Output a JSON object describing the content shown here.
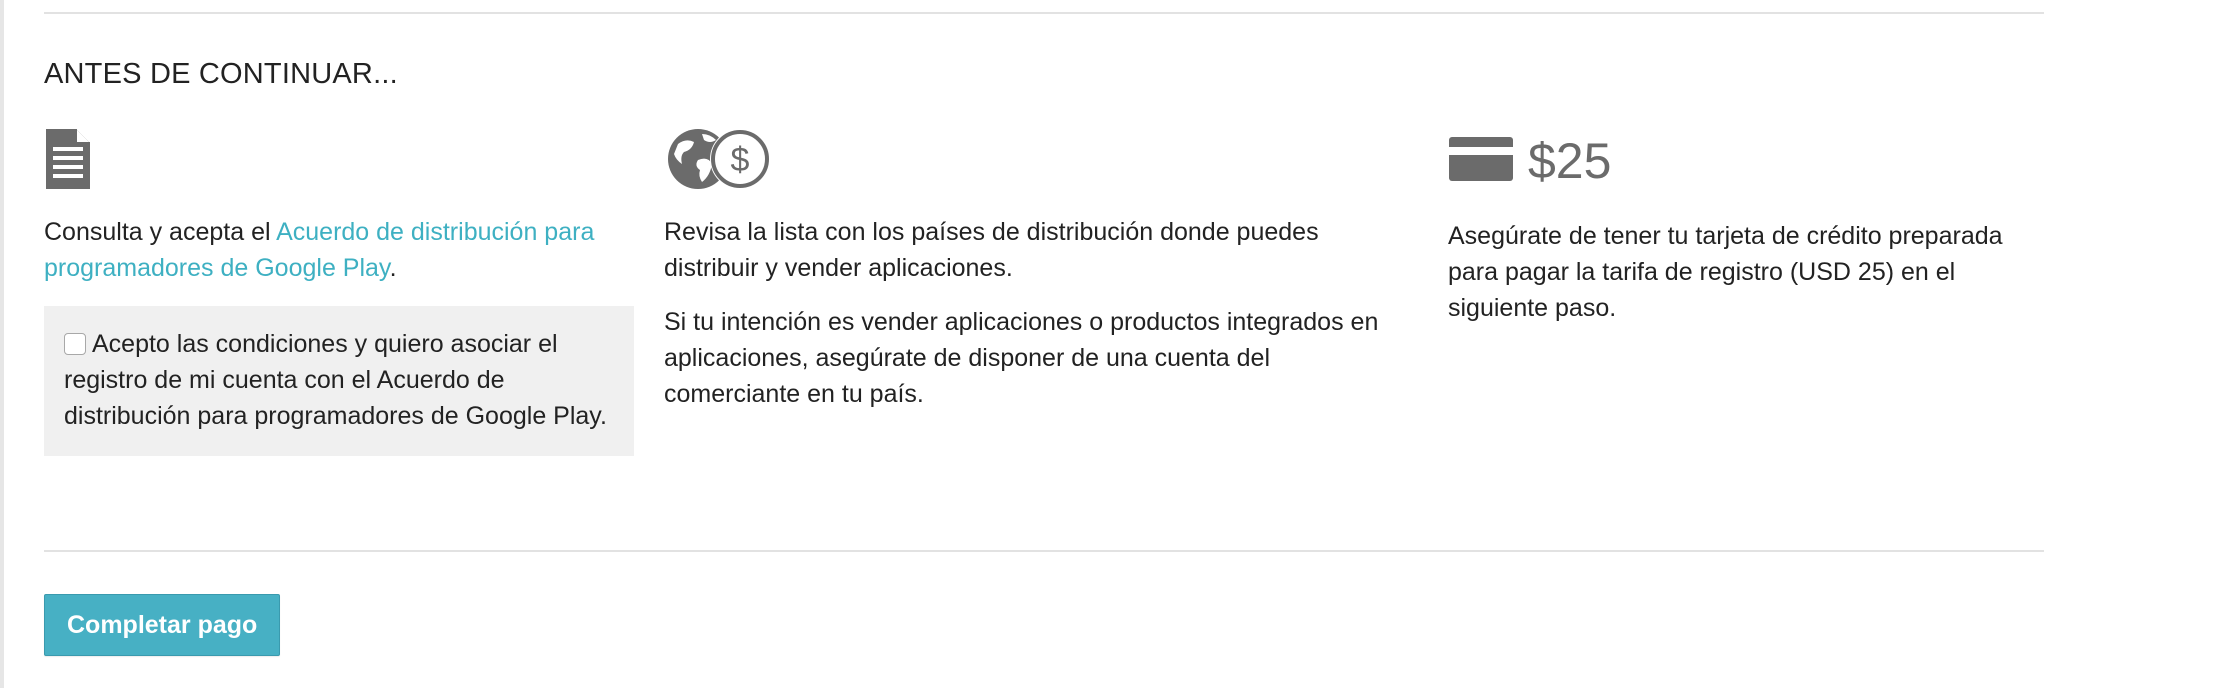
{
  "section": {
    "title": "ANTES DE CONTINUAR..."
  },
  "columns": {
    "agreement": {
      "icon": "document-icon",
      "text_before_link": "Consulta y acepta el ",
      "link_text": "Acuerdo de distribución para programadores de Google Play",
      "text_after_link": ".",
      "checkbox": {
        "checked": false,
        "label": "Acepto las condiciones y quiero asociar el registro de mi cuenta con el Acuerdo de distribución para programadores de Google Play."
      }
    },
    "countries": {
      "icon": "globe-dollar-icon",
      "paragraph_1": "Revisa la lista con los países de distribución donde puedes distribuir y vender aplicaciones.",
      "paragraph_2": "Si tu intención es vender aplicaciones o productos integrados en aplicaciones, asegúrate de disponer de una cuenta del comerciante en tu país."
    },
    "payment": {
      "icon": "credit-card-icon",
      "price": "$25",
      "paragraph": "Asegúrate de tener tu tarjeta de crédito preparada para pagar la tarifa de registro (USD 25) en el siguiente paso."
    }
  },
  "actions": {
    "pay_button_label": "Completar pago"
  },
  "colors": {
    "link": "#3eb0c2",
    "button": "#47b0c4",
    "icon_gray": "#6b6b6b",
    "box_background": "#f0f0f0"
  }
}
